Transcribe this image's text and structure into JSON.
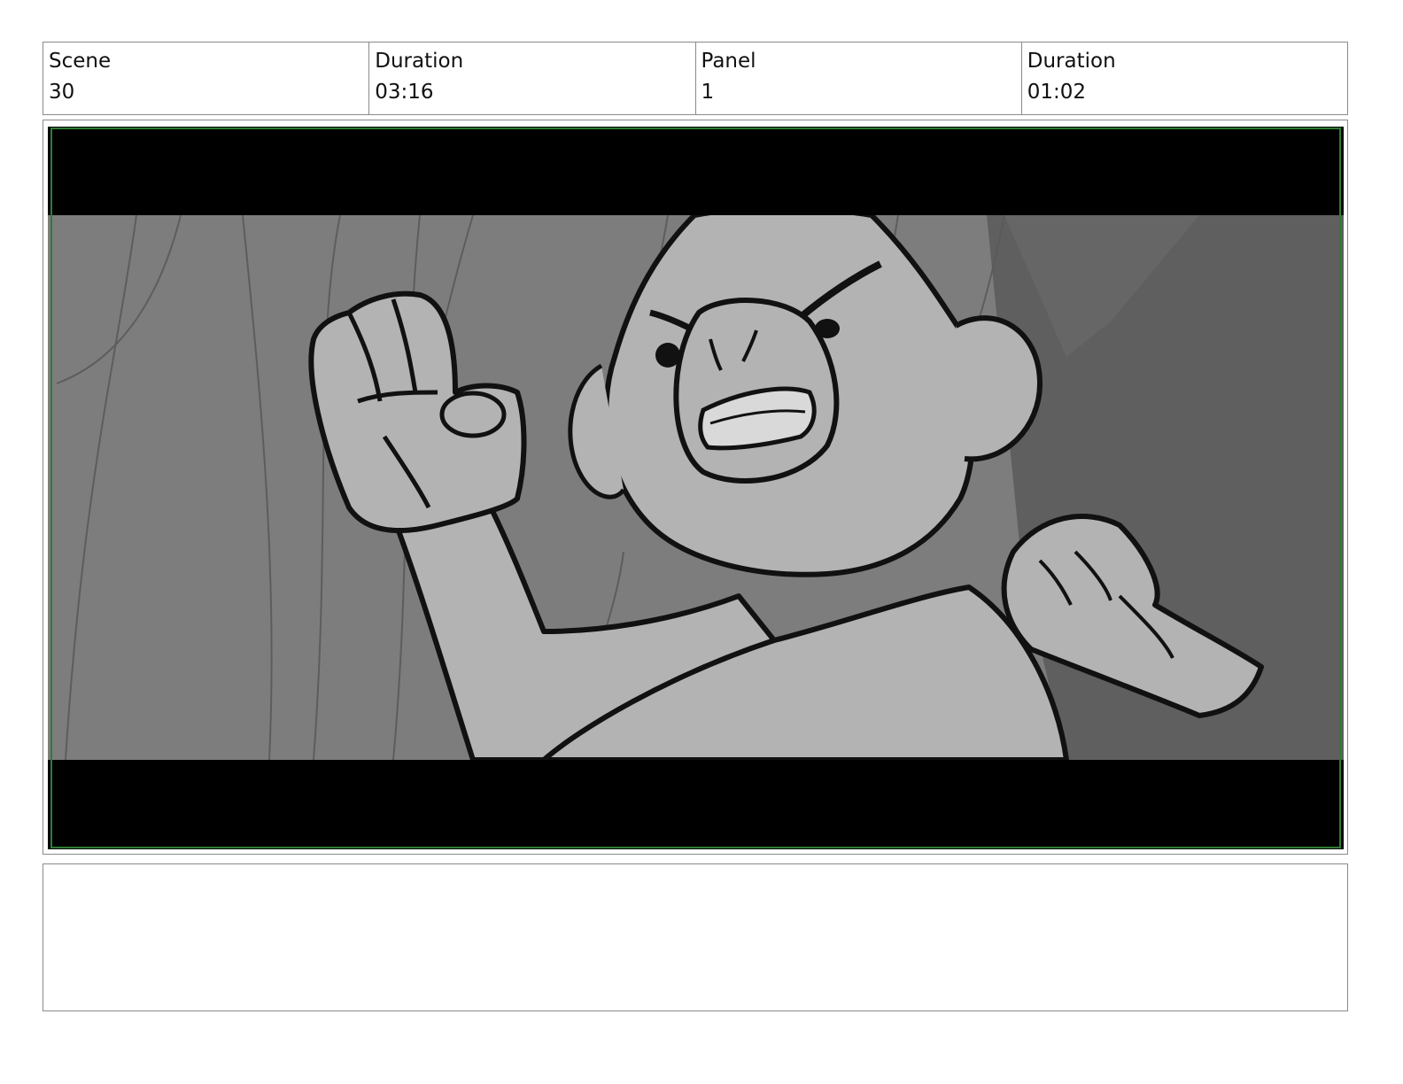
{
  "header": {
    "scene_label": "Scene",
    "scene_value": "30",
    "scene_duration_label": "Duration",
    "scene_duration_value": "03:16",
    "panel_label": "Panel",
    "panel_value": "1",
    "panel_duration_label": "Duration",
    "panel_duration_value": "01:02"
  },
  "panel": {
    "image_description_icon": "storyboard-sketch",
    "letterbox_color": "#000000",
    "safe_frame_color": "#2e7d32"
  },
  "notes": {
    "text": ""
  }
}
